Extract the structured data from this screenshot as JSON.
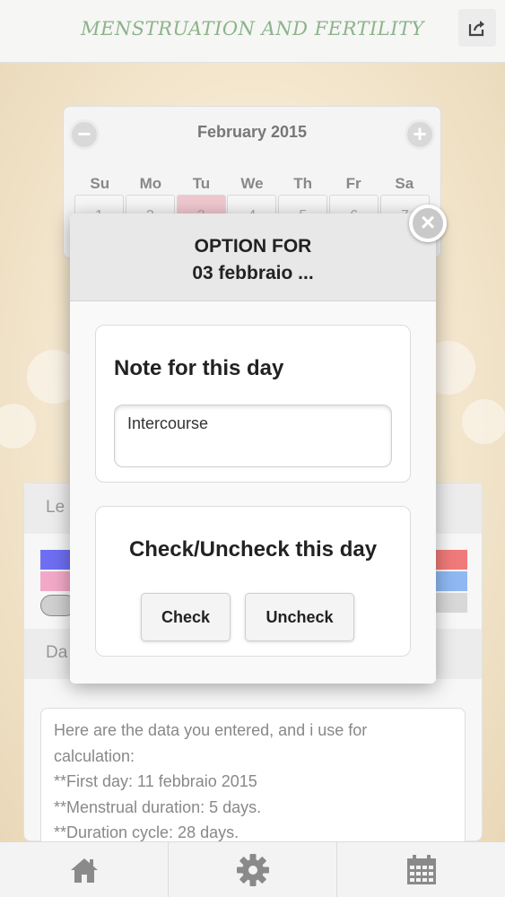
{
  "header": {
    "title": "MENSTRUATION AND FERTILITY",
    "share_icon": "share-icon"
  },
  "calendar": {
    "month": "February 2015",
    "prev_icon": "minus-icon",
    "next_icon": "plus-icon",
    "weekdays": [
      "Su",
      "Mo",
      "Tu",
      "We",
      "Th",
      "Fr",
      "Sa"
    ],
    "dates": [
      "1",
      "2",
      "3",
      "4",
      "5",
      "6",
      "7"
    ],
    "highlighted_date": "3"
  },
  "panel": {
    "legend_label": "Le",
    "data_label": "Da",
    "data_text": [
      "Here are the data you entered, and i use for",
      "calculation:",
      "**First day: 11 febbraio 2015",
      "**Menstrual duration: 5 days.",
      "**Duration cycle: 28 days."
    ],
    "legend_colors": [
      "#6e6ef2",
      "#f2a9c8",
      "#f07a7a",
      "#8fb8f2"
    ]
  },
  "modal": {
    "title_line1": "OPTION FOR",
    "title_line2": "03 febbraio ...",
    "note_title": "Note for this day",
    "note_value": "Intercourse",
    "check_title": "Check/Uncheck this day",
    "check_button": "Check",
    "uncheck_button": "Uncheck",
    "close_icon": "close-icon"
  },
  "bottom_nav": [
    {
      "name": "home",
      "icon": "home-icon"
    },
    {
      "name": "settings",
      "icon": "gear-icon"
    },
    {
      "name": "calendar",
      "icon": "calendar-icon"
    }
  ]
}
